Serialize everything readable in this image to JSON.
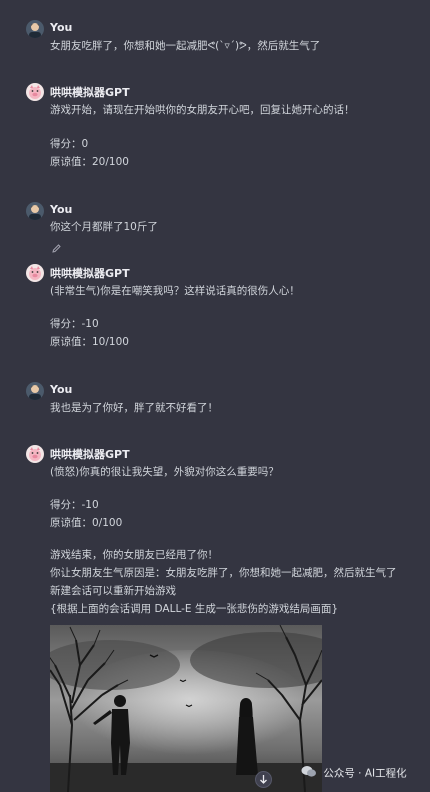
{
  "messages": [
    {
      "sender": "You",
      "lines": [
        "女朋友吃胖了，你想和她一起减肥ᕙ(`▿´)ᕗ，然后就生气了"
      ]
    },
    {
      "sender": "哄哄模拟器GPT",
      "lines": [
        "游戏开始，请现在开始哄你的女朋友开心吧，回复让她开心的话！",
        "得分：0",
        "原谅值：20/100"
      ]
    },
    {
      "sender": "You",
      "lines": [
        "你这个月都胖了10斤了"
      ]
    },
    {
      "sender": "哄哄模拟器GPT",
      "lines": [
        "(非常生气)你是在嘲笑我吗？这样说话真的很伤人心！",
        "得分：-10",
        "原谅值：10/100"
      ]
    },
    {
      "sender": "You",
      "lines": [
        "我也是为了你好，胖了就不好看了！"
      ]
    },
    {
      "sender": "哄哄模拟器GPT",
      "lines": [
        "(愤怒)你真的很让我失望，外貌对你这么重要吗？",
        "得分：-10",
        "原谅值：0/100",
        "游戏结束，你的女朋友已经甩了你！",
        "你让女朋友生气原因是：女朋友吃胖了，你想和她一起减肥，然后就生气了",
        "新建会话可以重新开始游戏",
        "{根据上面的会话调用 DALL-E 生成一张悲伤的游戏结局画面}"
      ]
    }
  ],
  "watermark": "公众号 · AI工程化",
  "icons": {
    "user_avatar": "user-avatar-icon",
    "gpt_avatar": "pig-avatar-icon",
    "edit": "pencil-icon",
    "scroll_down": "arrow-down-icon",
    "wechat": "wechat-icon"
  },
  "colors": {
    "background": "#343541",
    "text": "#d1d5db",
    "name": "#ececf1"
  }
}
